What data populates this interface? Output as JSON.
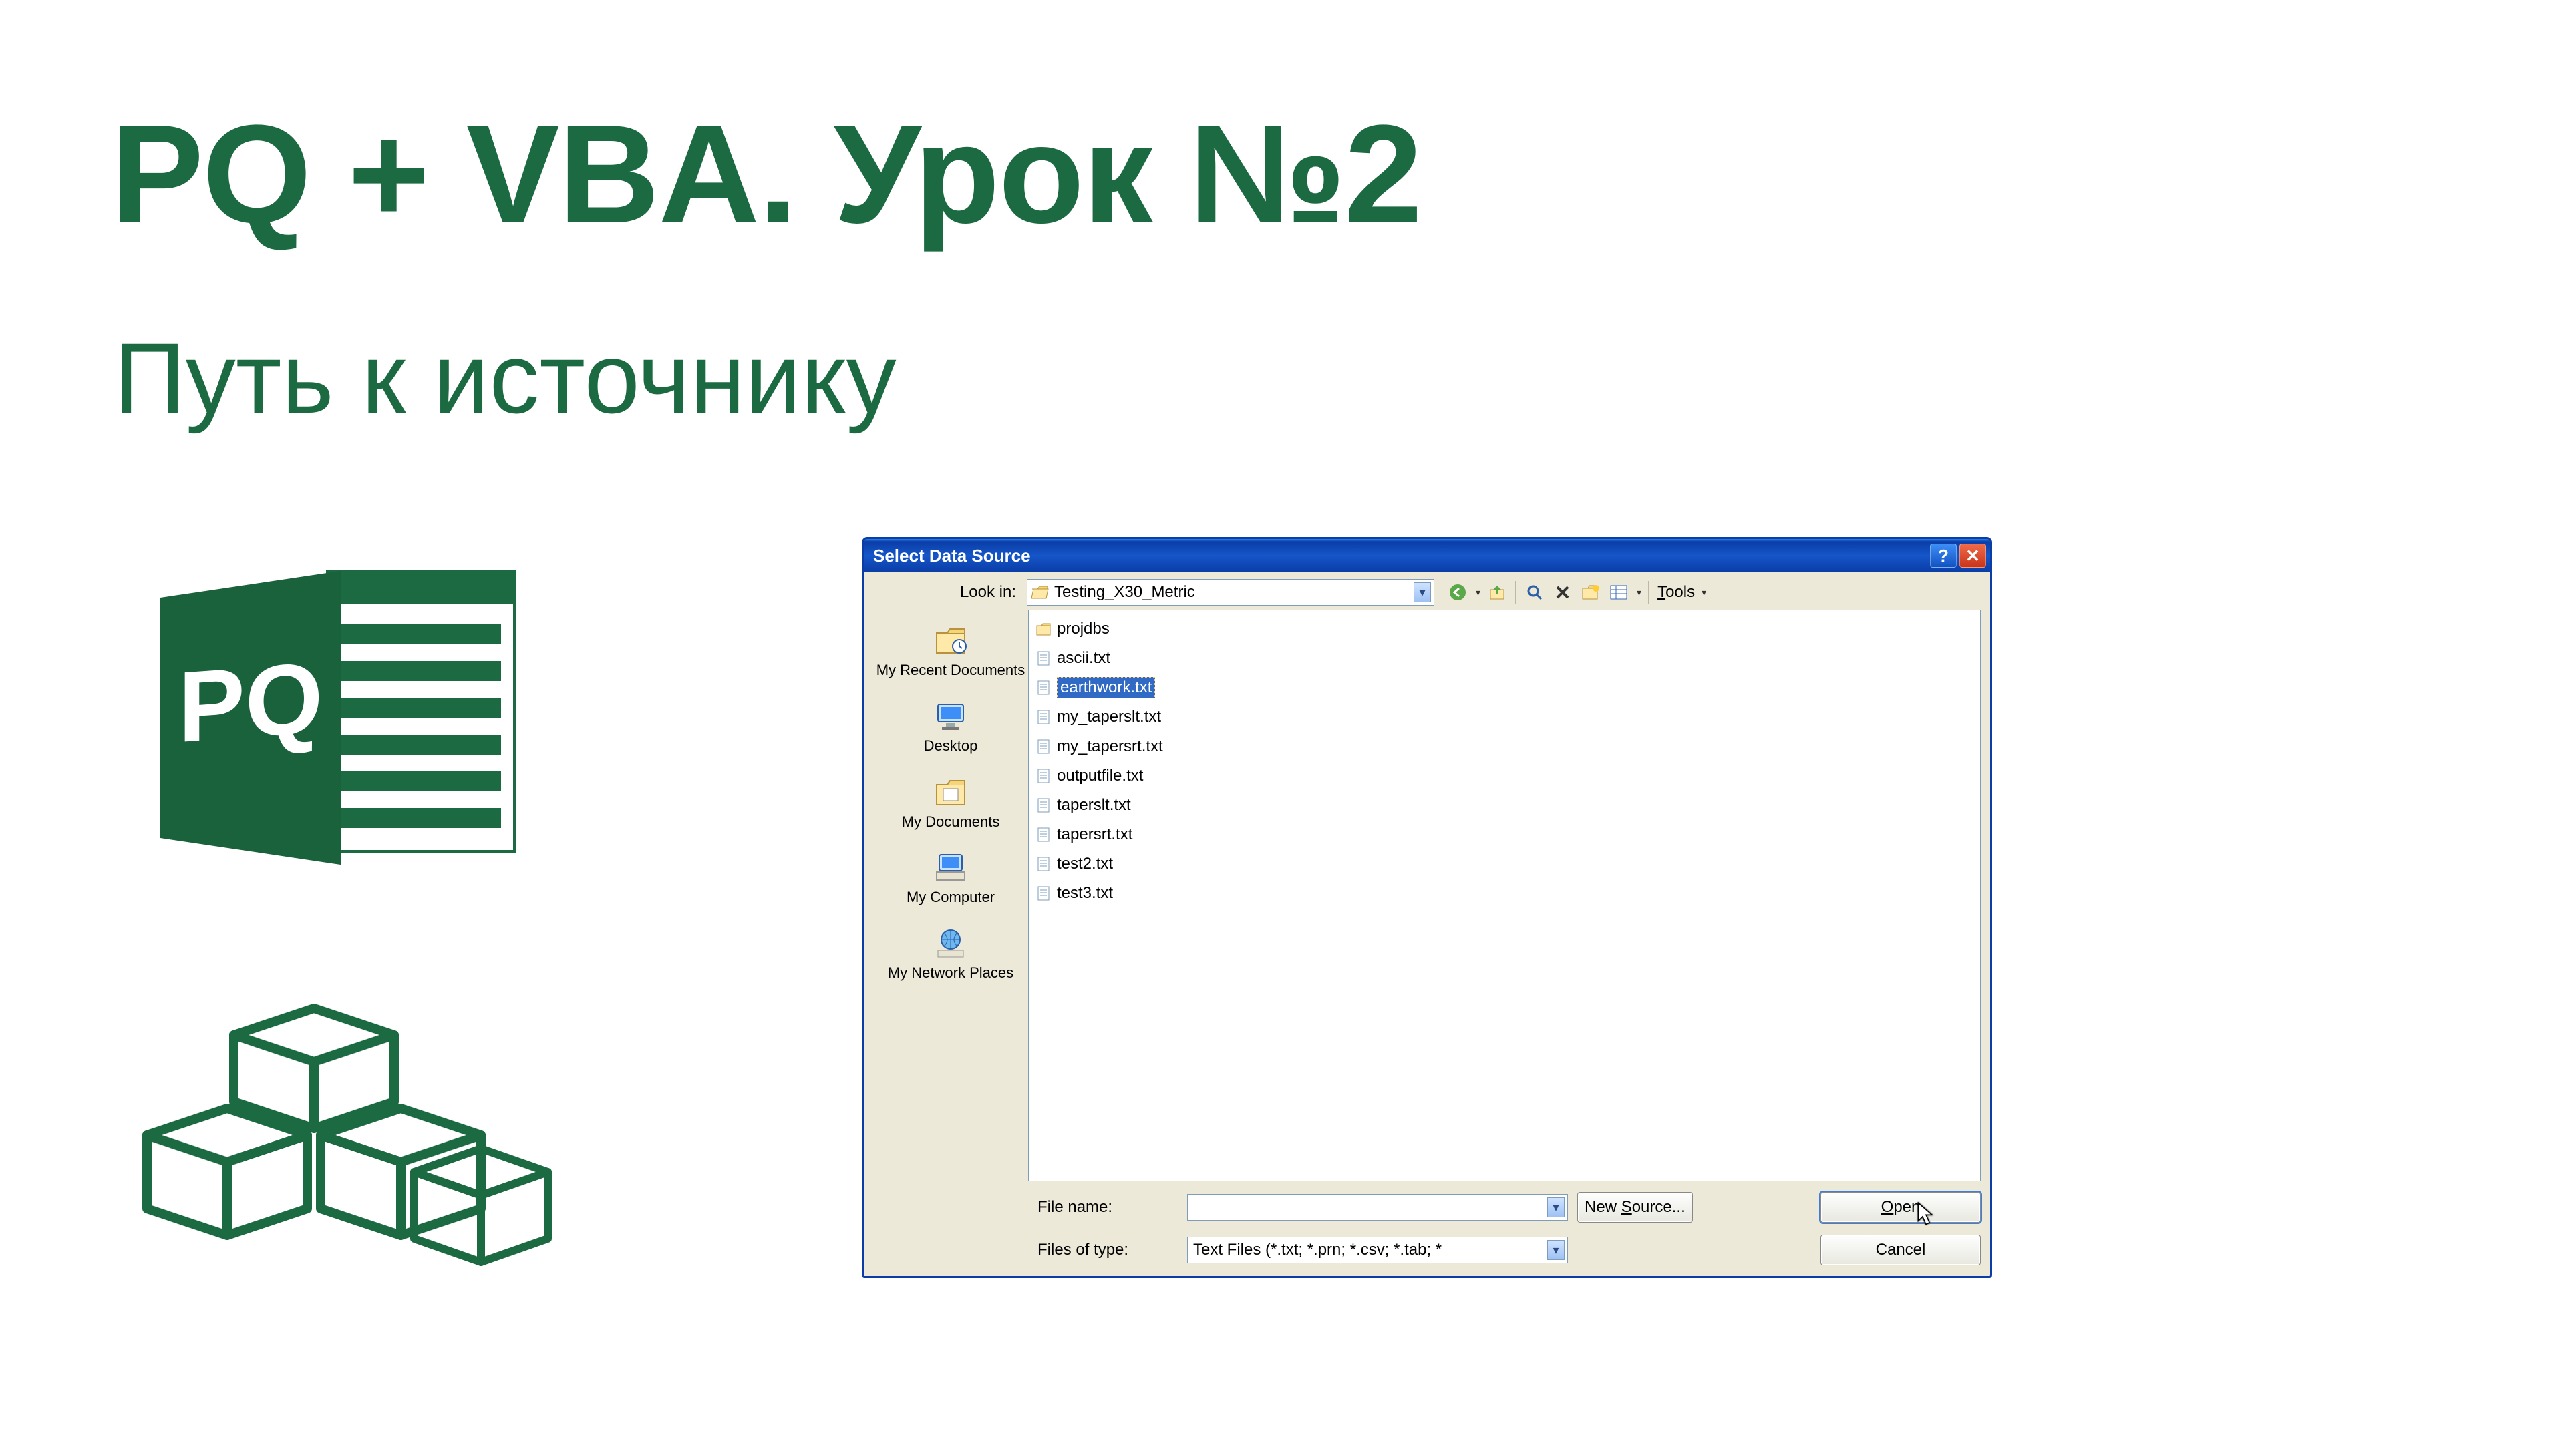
{
  "title_main": "PQ + VBA. Урок №2",
  "title_sub": "Путь к источнику",
  "pq_label": "PQ",
  "dialog": {
    "title": "Select Data Source",
    "help_glyph": "?",
    "close_glyph": "✕",
    "lookin_label": "Look in:",
    "lookin_value": "Testing_X30_Metric",
    "tools_label": "Tools",
    "places": [
      {
        "key": "recent",
        "label": "My Recent Documents"
      },
      {
        "key": "desktop",
        "label": "Desktop"
      },
      {
        "key": "mydocs",
        "label": "My Documents"
      },
      {
        "key": "mycomp",
        "label": "My Computer"
      },
      {
        "key": "network",
        "label": "My Network Places"
      }
    ],
    "files": [
      {
        "name": "projdbs",
        "type": "folder",
        "selected": false
      },
      {
        "name": "ascii.txt",
        "type": "txt",
        "selected": false
      },
      {
        "name": "earthwork.txt",
        "type": "txt",
        "selected": true
      },
      {
        "name": "my_taperslt.txt",
        "type": "txt",
        "selected": false
      },
      {
        "name": "my_tapersrt.txt",
        "type": "txt",
        "selected": false
      },
      {
        "name": "outputfile.txt",
        "type": "txt",
        "selected": false
      },
      {
        "name": "taperslt.txt",
        "type": "txt",
        "selected": false
      },
      {
        "name": "tapersrt.txt",
        "type": "txt",
        "selected": false
      },
      {
        "name": "test2.txt",
        "type": "txt",
        "selected": false
      },
      {
        "name": "test3.txt",
        "type": "txt",
        "selected": false
      }
    ],
    "filename_label": "File name:",
    "filename_value": "",
    "filetypes_label": "Files of type:",
    "filetypes_value": "Text Files (*.txt; *.prn; *.csv; *.tab; *",
    "new_source_label": "New Source...",
    "open_label": "Open",
    "cancel_label": "Cancel"
  },
  "colors": {
    "brand_green": "#1c6a41",
    "xp_blue_dark": "#0a3da6",
    "xp_blue_light": "#2a7bef",
    "xp_face": "#ece9d8",
    "select_bg": "#316ac5"
  }
}
